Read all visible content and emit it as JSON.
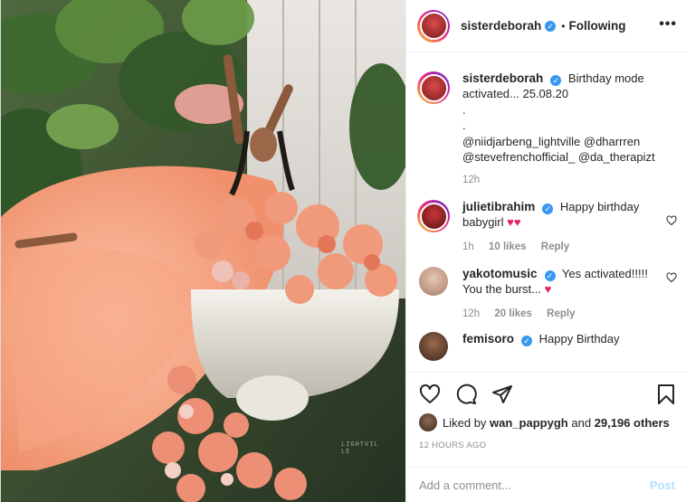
{
  "header": {
    "username": "sisterdeborah",
    "separator": "•",
    "follow_status": "Following",
    "more_icon": "ellipsis-icon"
  },
  "caption": {
    "username": "sisterdeborah",
    "text": "Birthday mode activated... 25.08.20",
    "dots": [
      ".",
      "."
    ],
    "mentions_line1": "@niidjarbeng_lightville @dharrren",
    "mentions_line2": "@stevefrenchofficial_ @da_therapizt",
    "time": "12h"
  },
  "comments": [
    {
      "username": "julietibrahim",
      "text": "Happy birthday",
      "text2": "babygirl",
      "time": "1h",
      "likes": "10 likes",
      "reply": "Reply"
    },
    {
      "username": "yakotomusic",
      "text": "Yes activated!!!!!",
      "text2": "You the burst...",
      "time": "12h",
      "likes": "20 likes",
      "reply": "Reply"
    },
    {
      "username": "femisoro",
      "text": "Happy Birthday"
    }
  ],
  "likes": {
    "prefix": "Liked by",
    "user": "wan_pappygh",
    "conj": "and",
    "others": "29,196 others"
  },
  "timestamp": "12 HOURS AGO",
  "add_comment": {
    "placeholder": "Add a comment...",
    "post_label": "Post"
  },
  "photo": {
    "watermark": "LIGHTVILLE"
  },
  "colors": {
    "link": "#00376b",
    "verified": "#3897f0",
    "muted": "#8e8e8e",
    "post_disabled": "#b2dffc",
    "heart": "#e0245e"
  }
}
